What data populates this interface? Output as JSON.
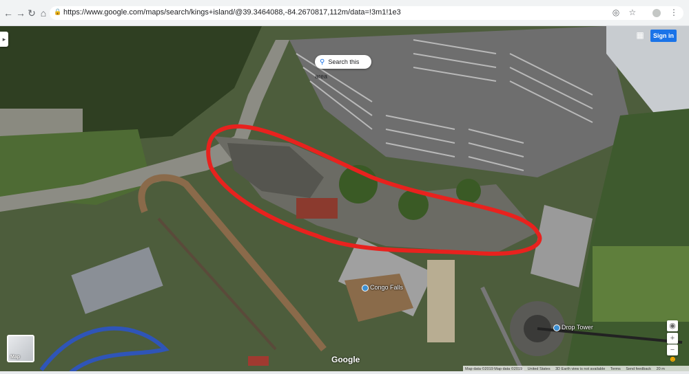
{
  "browser": {
    "url": "https://www.google.com/maps/search/kings+island/@39.3464088,-84.2670817,112m/data=!3m1!1e3",
    "back_icon": "arrow-left-icon",
    "forward_icon": "arrow-right-icon",
    "reload_icon": "reload-icon",
    "home_icon": "home-icon"
  },
  "map": {
    "search_area_label": "Search this area",
    "sign_in_label": "Sign in",
    "layer_label": "Map",
    "logo": "Google",
    "places": {
      "congo_falls": "Congo Falls",
      "drop_tower": "Drop Tower"
    },
    "zoom_in": "+",
    "zoom_out": "−",
    "footer": {
      "map_data": "Map data ©2019  Map data ©2019",
      "country": "United States",
      "earth_view": "3D Earth view is not available",
      "terms": "Terms",
      "feedback": "Send feedback",
      "scale": "20 m"
    }
  },
  "colors": {
    "annotation_circle": "#e8221e",
    "brand_blue": "#1a73e8"
  }
}
